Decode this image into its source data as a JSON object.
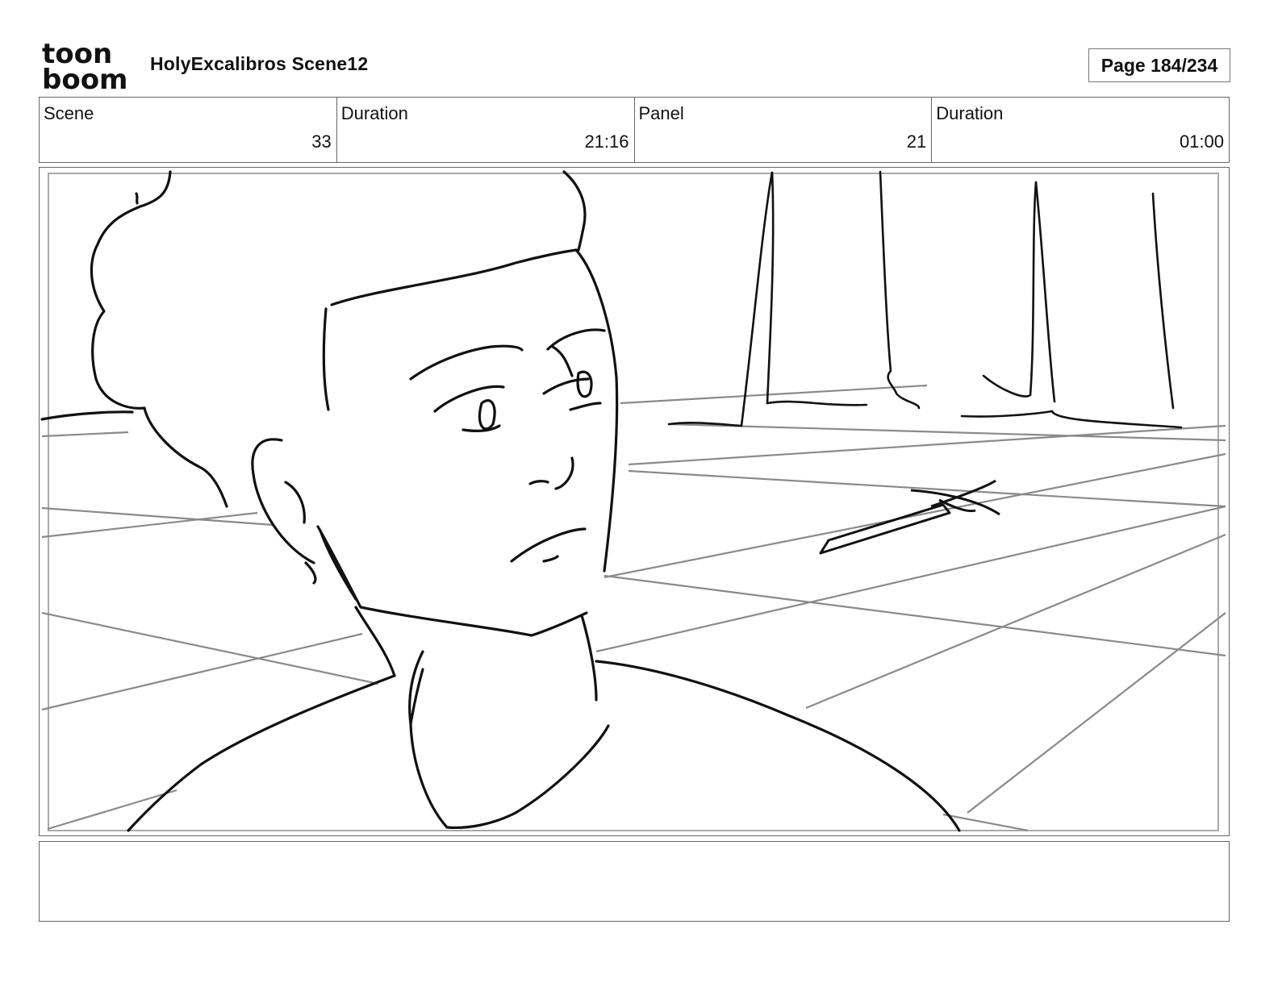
{
  "header": {
    "logo_line1": "toon",
    "logo_line2": "boom",
    "project_title": "HolyExcalibros Scene12",
    "page_label": "Page 184/234"
  },
  "info": [
    {
      "label": "Scene",
      "value": "33"
    },
    {
      "label": "Duration",
      "value": "21:16"
    },
    {
      "label": "Panel",
      "value": "21"
    },
    {
      "label": "Duration",
      "value": "01:00"
    }
  ],
  "notes": {
    "text": ""
  },
  "colors": {
    "ink": "#111111",
    "guide": "#8a8a8a",
    "border": "#666666"
  }
}
